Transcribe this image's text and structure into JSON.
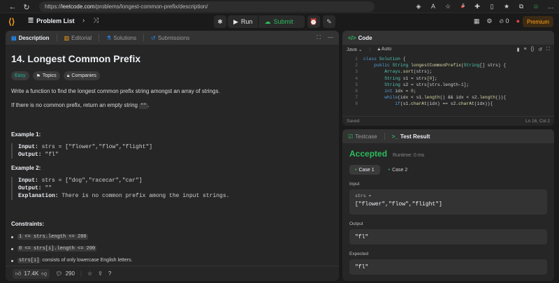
{
  "browser": {
    "url_prefix": "https://",
    "url_host": "leetcode.com",
    "url_path": "/problems/longest-common-prefix/description/",
    "ext_badge": "5"
  },
  "topbar": {
    "problem_list": "Problem List",
    "run": "Run",
    "submit": "Submit",
    "fire_count": "0",
    "premium": "Premium"
  },
  "left": {
    "tabs": [
      "Description",
      "Editorial",
      "Solutions",
      "Submissions"
    ],
    "title": "14. Longest Common Prefix",
    "tags": [
      "Easy",
      "Topics",
      "Companies"
    ],
    "statement_line1": "Write a function to find the longest common prefix string amongst an array of strings.",
    "statement_line2_pre": "If there is no common prefix, return an empty string ",
    "statement_line2_code": "\"\"",
    "statement_line2_post": ".",
    "example1": {
      "heading": "Example 1:",
      "input_label": "Input:",
      "input": " strs = [\"flower\",\"flow\",\"flight\"]",
      "output_label": "Output:",
      "output": " \"fl\""
    },
    "example2": {
      "heading": "Example 2:",
      "input_label": "Input:",
      "input": " strs = [\"dog\",\"racecar\",\"car\"]",
      "output_label": "Output:",
      "output": " \"\"",
      "expl_label": "Explanation:",
      "expl": " There is no common prefix among the input strings."
    },
    "constraints_heading": "Constraints:",
    "constraints": [
      {
        "code": "1 <= strs.length <= 200",
        "text": ""
      },
      {
        "code": "0 <= strs[i].length <= 200",
        "text": ""
      },
      {
        "code": "strs[i]",
        "text": " consists of only lowercase English letters."
      }
    ],
    "likes": "17.4K",
    "comments": "290"
  },
  "code_panel": {
    "title": "Code",
    "language": "Java",
    "mode": "Auto",
    "lines": [
      {
        "n": "1",
        "html": "<span class='kw'>class</span> <span class='ty'>Solution</span> {"
      },
      {
        "n": "2",
        "html": "    <span class='kw'>public</span> <span class='ty'>String</span> <span class='fn'>longestCommonPrefix</span>(<span class='ty'>String</span>[] strs) {"
      },
      {
        "n": "3",
        "html": "        <span class='ty'>Arrays</span>.<span class='fn'>sort</span>(strs);"
      },
      {
        "n": "4",
        "html": "        <span class='ty'>String</span> s1 = strs[<span class='nu'>0</span>];"
      },
      {
        "n": "5",
        "html": "        <span class='ty'>String</span> s2 = strs[strs.length-<span class='nu'>1</span>];"
      },
      {
        "n": "6",
        "html": "        <span class='kw'>int</span> idx = <span class='nu'>0</span>;"
      },
      {
        "n": "7",
        "html": "        <span class='kw'>while</span>(idx &lt; s1.<span class='fn'>length</span>() &amp;&amp; idx &lt; s2.<span class='fn'>length</span>()){"
      },
      {
        "n": "8",
        "html": "            <span class='kw'>if</span>(s1.<span class='fn'>charAt</span>(idx) == s2.<span class='fn'>charAt</span>(idx)){"
      }
    ],
    "status_left": "Saved",
    "status_right": "Ln 16, Col 2"
  },
  "result_panel": {
    "tab_testcase": "Testcase",
    "tab_result": "Test Result",
    "verdict": "Accepted",
    "runtime": "Runtime: 0 ms",
    "cases": [
      "Case 1",
      "Case 2"
    ],
    "input_label": "Input",
    "var_name": "strs =",
    "var_value": "[\"flower\",\"flow\",\"flight\"]",
    "output_label": "Output",
    "output_value": "\"fl\"",
    "expected_label": "Expected",
    "expected_value": "\"fl\""
  }
}
